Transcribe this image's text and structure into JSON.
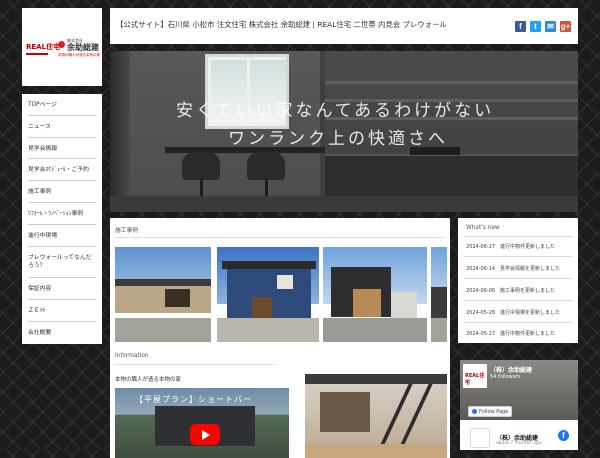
{
  "logo": {
    "real": "REAL住宅",
    "company_small": "株式会社",
    "company": "余助総建",
    "tagline": "本物の職人が造る本物の家"
  },
  "header": {
    "title": "【公式サイト】石川県 小松市 注文住宅 株式会社 余助総建 | REAL住宅 二世帯 内見会 プレウォール",
    "social": [
      {
        "icon": "facebook-icon",
        "glyph": "f",
        "color": "#3b5998"
      },
      {
        "icon": "twitter-icon",
        "glyph": "t",
        "color": "#1da1f2"
      },
      {
        "icon": "email-icon",
        "glyph": "✉",
        "color": "#2d8bd8"
      },
      {
        "icon": "google-plus-icon",
        "glyph": "g+",
        "color": "#dd4b39"
      }
    ]
  },
  "hero": {
    "catch1": "安くていい家なんてあるわけがない",
    "catch2": "ワンランク上の快適さへ"
  },
  "nav": {
    "items": [
      {
        "label": "TOPページ"
      },
      {
        "label": "ニュース"
      },
      {
        "label": "見学会情報"
      },
      {
        "label": "見学会ｽｹｼﾞｭｰﾙ・ご予約"
      },
      {
        "label": "施工事例"
      },
      {
        "label": "ﾘﾌｫｰﾑ・ﾘﾉﾍﾞｰｼｮﾝ事例"
      },
      {
        "label": "進行中現場"
      },
      {
        "label": "プレウォールってなんだろう？"
      },
      {
        "label": "保証内容"
      },
      {
        "label": "ＺＥＨ"
      },
      {
        "label": "会社概要"
      }
    ]
  },
  "main": {
    "works_title": "施工事例",
    "info_title": "Information",
    "info_heading": "本物の職人が造る本物の家",
    "video_title": "【平屋プラン】ショートバー"
  },
  "news": {
    "title": "What's new",
    "items": [
      {
        "date": "2024-06-27",
        "text": "進行中物件更新しました"
      },
      {
        "date": "2024-06-14",
        "text": "見学会情報を更新しました"
      },
      {
        "date": "2024-06-06",
        "text": "施工事例を更新しました"
      },
      {
        "date": "2024-05-28",
        "text": "進行中現場を更新しました"
      },
      {
        "date": "2024-05-27",
        "text": "進行中物件更新しました"
      }
    ]
  },
  "facebook": {
    "page_name": "（株）余助総建",
    "followers": "54 followers",
    "follow_label": "Follow Page",
    "post_name": "（株）余助総建",
    "post_time": "about 7 months ago"
  }
}
